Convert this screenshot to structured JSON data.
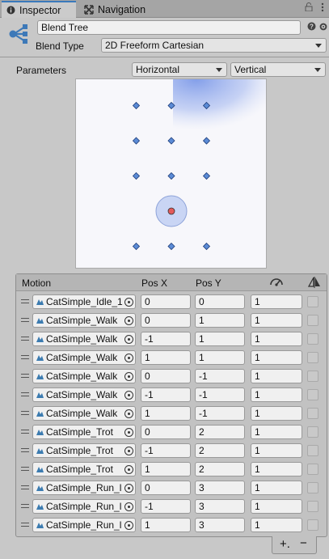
{
  "tabs": [
    {
      "label": "Inspector",
      "icon": "info-icon"
    },
    {
      "label": "Navigation",
      "icon": "navigation-icon"
    }
  ],
  "header": {
    "name_value": "Blend Tree",
    "blend_type_label": "Blend Type",
    "blend_type_value": "2D Freeform Cartesian"
  },
  "parameters": {
    "label": "Parameters",
    "param_x": "Horizontal",
    "param_y": "Vertical"
  },
  "list": {
    "col_motion": "Motion",
    "col_posx": "Pos X",
    "col_posy": "Pos Y",
    "rows": [
      {
        "motion": "CatSimple_Idle_1",
        "x": "0",
        "y": "0",
        "speed": "1",
        "mirror": false
      },
      {
        "motion": "CatSimple_Walk",
        "x": "0",
        "y": "1",
        "speed": "1",
        "mirror": false
      },
      {
        "motion": "CatSimple_Walk",
        "x": "-1",
        "y": "1",
        "speed": "1",
        "mirror": false
      },
      {
        "motion": "CatSimple_Walk",
        "x": "1",
        "y": "1",
        "speed": "1",
        "mirror": false
      },
      {
        "motion": "CatSimple_Walk",
        "x": "0",
        "y": "-1",
        "speed": "1",
        "mirror": false
      },
      {
        "motion": "CatSimple_Walk",
        "x": "-1",
        "y": "-1",
        "speed": "1",
        "mirror": false
      },
      {
        "motion": "CatSimple_Walk",
        "x": "1",
        "y": "-1",
        "speed": "1",
        "mirror": false
      },
      {
        "motion": "CatSimple_Trot",
        "x": "0",
        "y": "2",
        "speed": "1",
        "mirror": false
      },
      {
        "motion": "CatSimple_Trot",
        "x": "-1",
        "y": "2",
        "speed": "1",
        "mirror": false
      },
      {
        "motion": "CatSimple_Trot",
        "x": "1",
        "y": "2",
        "speed": "1",
        "mirror": false
      },
      {
        "motion": "CatSimple_Run_l",
        "x": "0",
        "y": "3",
        "speed": "1",
        "mirror": false
      },
      {
        "motion": "CatSimple_Run_l",
        "x": "-1",
        "y": "3",
        "speed": "1",
        "mirror": false
      },
      {
        "motion": "CatSimple_Run_l",
        "x": "1",
        "y": "3",
        "speed": "1",
        "mirror": false
      }
    ],
    "add_label": "+.",
    "remove_label": "−"
  },
  "colors": {
    "accent": "#3a79bb",
    "node": "#5b8bd6",
    "active_point": "#e35a5a",
    "influence": "#6f8fe6"
  }
}
